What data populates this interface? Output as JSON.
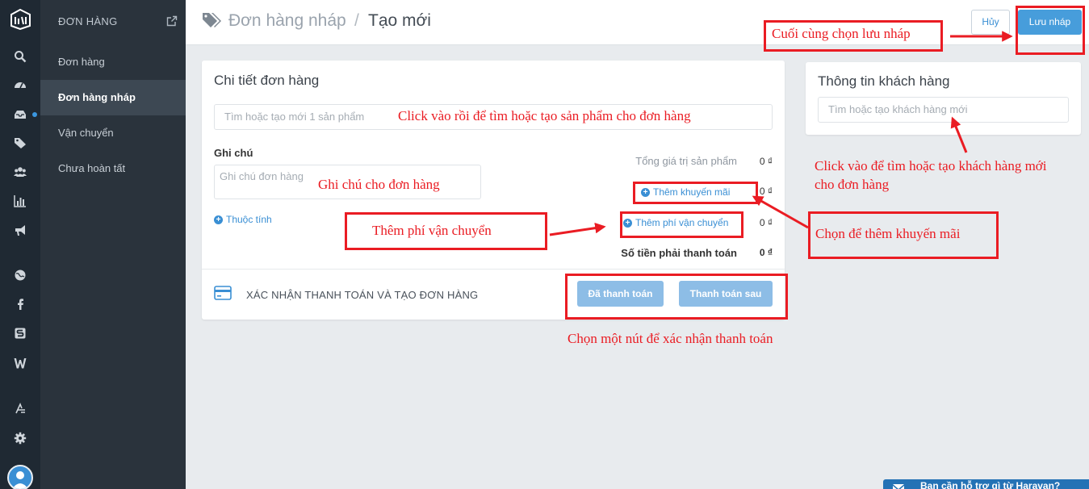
{
  "sidebar": {
    "section_title": "ĐƠN HÀNG",
    "items": [
      {
        "label": "Đơn hàng"
      },
      {
        "label": "Đơn hàng nháp"
      },
      {
        "label": "Vận chuyển"
      },
      {
        "label": "Chưa hoàn tất"
      }
    ]
  },
  "header": {
    "breadcrumb_parent": "Đơn hàng nháp",
    "breadcrumb_separator": "/",
    "breadcrumb_current": "Tạo mới",
    "cancel_label": "Hủy",
    "save_label": "Lưu nháp"
  },
  "order_card": {
    "title": "Chi tiết đơn hàng",
    "product_search_placeholder": "Tìm hoặc tạo mới 1 sản phẩm",
    "note_label": "Ghi chú",
    "note_placeholder": "Ghi chú đơn hàng",
    "attributes_link": "Thuộc tính",
    "summary": {
      "product_total_label": "Tổng giá trị sản phẩm",
      "product_total_value": "0 ₫",
      "discount_link": "Thêm khuyến mãi",
      "discount_value": "0 ₫",
      "shipping_link": "Thêm phí vận chuyển",
      "shipping_value": "0 ₫",
      "due_label": "Số tiền phải thanh toán",
      "due_value": "0 ₫"
    },
    "payment_section_label": "XÁC NHẬN THANH TOÁN VÀ TẠO ĐƠN HÀNG",
    "paid_button": "Đã thanh toán",
    "pay_later_button": "Thanh toán sau"
  },
  "customer_card": {
    "title": "Thông tin khách hàng",
    "search_placeholder": "Tìm hoặc tạo khách hàng mới"
  },
  "annotations": {
    "save": "Cuối cùng chọn lưu nháp",
    "product": "Click vào rồi để tìm hoặc tạo sản phẩm cho đơn hàng",
    "note": "Ghi chú cho đơn hàng",
    "shipping": "Thêm phí vận chuyển",
    "discount": "Chọn để thêm khuyến mãi",
    "customer_line1": "Click vào để tìm hoặc tạo khách hàng mới",
    "customer_line2": "cho đơn hàng",
    "payment": "Chọn một nút để xác nhận thanh toán"
  },
  "help_widget": {
    "label": "Bạn cần hỗ trợ gì từ Haravan?"
  },
  "icons": [
    "logo-icon",
    "search-icon",
    "dashboard-icon",
    "inbox-icon",
    "tag-icon",
    "users-icon",
    "bar-chart-icon",
    "megaphone-icon",
    "globe-icon",
    "facebook-icon",
    "s-icon",
    "w-icon",
    "apps-icon",
    "gear-icon",
    "external-link-icon",
    "credit-card-icon",
    "envelope-icon"
  ],
  "colors": {
    "accent": "#479ddb",
    "annotation": "#ea1c23",
    "rail_bg": "#1f2933",
    "sidebar_bg": "#2a333c"
  }
}
